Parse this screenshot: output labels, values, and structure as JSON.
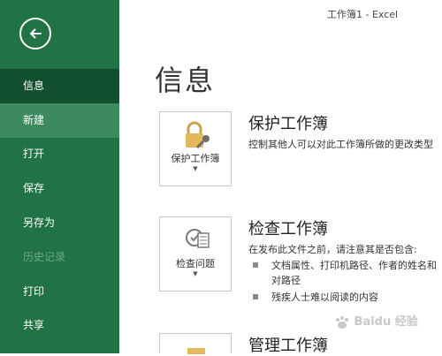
{
  "window": {
    "title": "工作簿1  -  Excel"
  },
  "sidebar": {
    "items": [
      {
        "label": "信息"
      },
      {
        "label": "新建"
      },
      {
        "label": "打开"
      },
      {
        "label": "保存"
      },
      {
        "label": "另存为"
      },
      {
        "label": "历史记录"
      },
      {
        "label": "打印"
      },
      {
        "label": "共享"
      }
    ]
  },
  "main": {
    "title": "信息",
    "sections": [
      {
        "tile_label": "保护工作簿",
        "title": "保护工作簿",
        "desc": "控制其他人可以对此工作簿所做的更改类型"
      },
      {
        "tile_label": "检查问题",
        "title": "检查工作簿",
        "desc": "在发布此文件之前，请注意其是否包含:",
        "bullets": [
          "文档属性、打印机路径、作者的姓名和",
          "对路径",
          "残疾人士难以阅读的内容"
        ]
      },
      {
        "title": "管理工作簿"
      }
    ]
  },
  "watermark": {
    "text": "Baidu 经验"
  },
  "colors": {
    "sidebar": "#217346",
    "active": "#124f2e",
    "hover": "#3c8a5e"
  }
}
